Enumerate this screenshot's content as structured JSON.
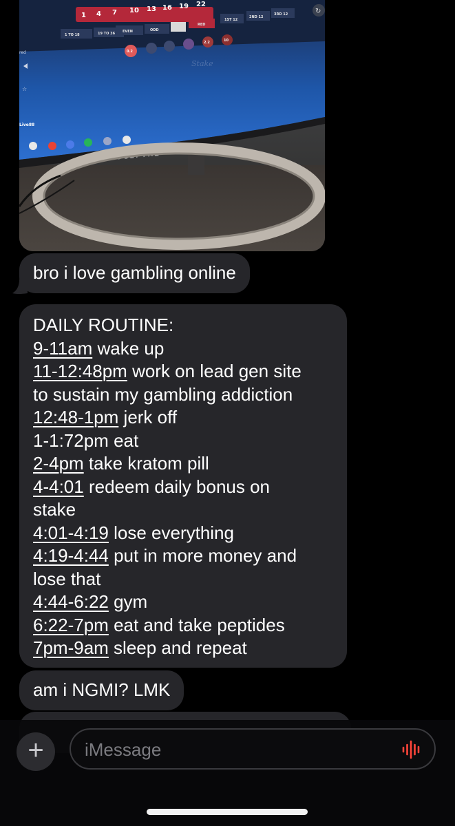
{
  "photo": {
    "numbers_row": [
      "1",
      "4",
      "7",
      "10",
      "13",
      "16",
      "19",
      "22"
    ],
    "bets_row": [
      "1 TO 18",
      "19 TO 36",
      "EVEN",
      "ODD",
      "RED",
      "1ST 12",
      "2ND 12",
      "3RD 12"
    ],
    "chips": [
      "0.2",
      "",
      "",
      "",
      "2.2",
      "10"
    ],
    "site_watermark": "Stake",
    "sidebar_label": "red",
    "live_label": "Live88",
    "monitor_brand": "SCEPTRE"
  },
  "messages": {
    "gambling": "bro i love gambling online",
    "routine_title": "DAILY ROUTINE:",
    "routine": [
      {
        "time": "9-11am",
        "text": " wake up"
      },
      {
        "time": "11-12:48pm",
        "text": " work on lead gen site"
      },
      {
        "time": "",
        "text": "to sustain my gambling addiction"
      },
      {
        "time": "12:48-1pm",
        "text": " jerk off"
      },
      {
        "time": "",
        "text": "1-1:72pm eat"
      },
      {
        "time": "2-4pm",
        "text": " take kratom pill"
      },
      {
        "time": "4-4:01",
        "text": " redeem daily bonus on"
      },
      {
        "time": "",
        "text": "stake"
      },
      {
        "time": "4:01-4:19",
        "text": " lose everything"
      },
      {
        "time": "4:19-4:44",
        "text": " put in more money and"
      },
      {
        "time": "",
        "text": "lose that"
      },
      {
        "time": "4:44-6:22",
        "text": " gym"
      },
      {
        "time": "6:22-7pm",
        "text": " eat and take peptides"
      },
      {
        "time": "7pm-9am",
        "text": " sleep and repeat"
      }
    ],
    "ngmi": "am i NGMI? LMK"
  },
  "input": {
    "placeholder": "iMessage",
    "value": ""
  },
  "colors": {
    "bubble_bg": "#26262a",
    "audio_icon": "#ff453a",
    "background": "#000000"
  }
}
